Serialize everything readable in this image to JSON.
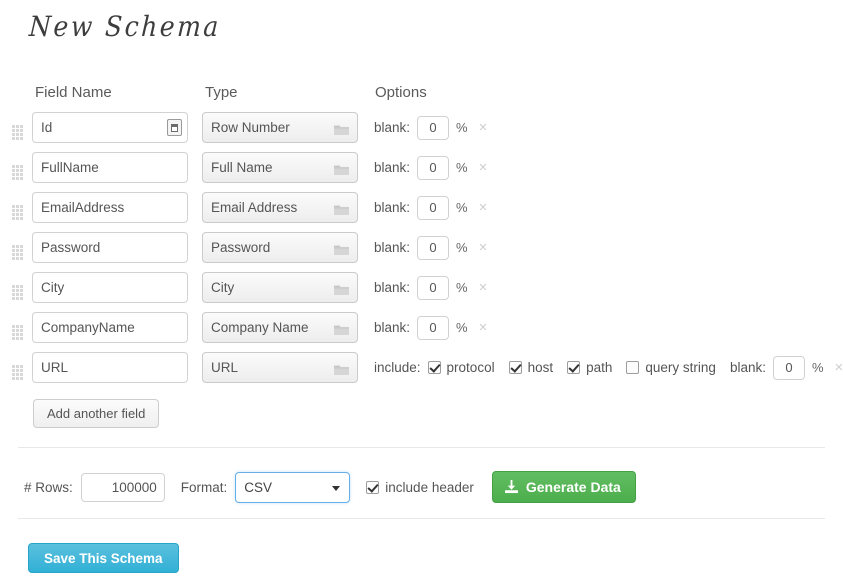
{
  "page": {
    "title": "New Schema"
  },
  "headers": {
    "field_name": "Field Name",
    "type": "Type",
    "options": "Options"
  },
  "labels": {
    "blank": "blank:",
    "percent": "%",
    "include": "include:",
    "remove": "×",
    "rows": "# Rows:",
    "format": "Format:",
    "include_header": "include header"
  },
  "rows": [
    {
      "field_name": "Id",
      "type": "Row Number",
      "blank": "0",
      "has_addon": true,
      "folder_icon": "folder-icon",
      "addon_icon": "row-number-icon"
    },
    {
      "field_name": "FullName",
      "type": "Full Name",
      "blank": "0",
      "has_addon": false,
      "folder_icon": "folder-icon"
    },
    {
      "field_name": "EmailAddress",
      "type": "Email Address",
      "blank": "0",
      "has_addon": false,
      "folder_icon": "folder-icon"
    },
    {
      "field_name": "Password",
      "type": "Password",
      "blank": "0",
      "has_addon": false,
      "folder_icon": "folder-icon"
    },
    {
      "field_name": "City",
      "type": "City",
      "blank": "0",
      "has_addon": false,
      "folder_icon": "folder-icon"
    },
    {
      "field_name": "CompanyName",
      "type": "Company Name",
      "blank": "0",
      "has_addon": false,
      "folder_icon": "folder-icon"
    },
    {
      "field_name": "URL",
      "type": "URL",
      "blank": "0",
      "has_addon": false,
      "folder_icon": "folder-icon",
      "url_options": [
        {
          "label": "protocol",
          "checked": true
        },
        {
          "label": "host",
          "checked": true
        },
        {
          "label": "path",
          "checked": true
        },
        {
          "label": "query string",
          "checked": false
        }
      ]
    }
  ],
  "buttons": {
    "add_field": "Add another field",
    "generate": "Generate Data",
    "save_schema": "Save This Schema"
  },
  "bottom": {
    "rows_value": "100000",
    "format_value": "CSV",
    "include_header_checked": true,
    "download_icon": "download-icon"
  },
  "colors": {
    "generate_green": "#4cae4c",
    "save_blue": "#31b0d5",
    "focus_blue": "#66afe9",
    "border_gray": "#d2d2d2"
  }
}
